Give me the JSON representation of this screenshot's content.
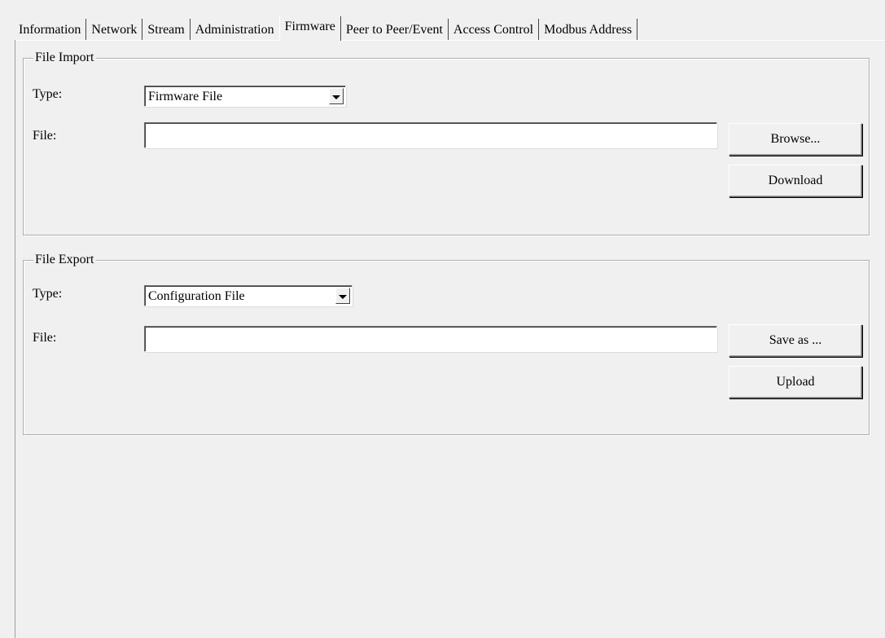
{
  "tabs": [
    {
      "label": "Information"
    },
    {
      "label": "Network"
    },
    {
      "label": "Stream"
    },
    {
      "label": "Administration"
    },
    {
      "label": "Firmware",
      "active": true
    },
    {
      "label": "Peer to Peer/Event"
    },
    {
      "label": "Access Control"
    },
    {
      "label": "Modbus Address"
    }
  ],
  "file_import": {
    "title": "File Import",
    "type_label": "Type:",
    "type_value": "Firmware File",
    "file_label": "File:",
    "file_value": "",
    "browse_label": "Browse...",
    "download_label": "Download"
  },
  "file_export": {
    "title": "File Export",
    "type_label": "Type:",
    "type_value": "Configuration File",
    "file_label": "File:",
    "file_value": "",
    "save_as_label": "Save as ...",
    "upload_label": "Upload"
  },
  "colors": {
    "background": "#f0f0f0",
    "field": "#ffffff",
    "border_dark": "#696969",
    "border_light": "#ffffff"
  }
}
